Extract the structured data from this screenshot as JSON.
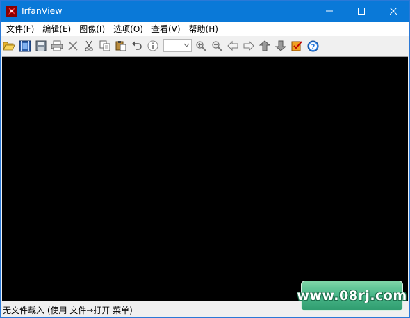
{
  "window": {
    "title": "IrfanView"
  },
  "menu": [
    {
      "label": "文件(F)"
    },
    {
      "label": "编辑(E)"
    },
    {
      "label": "图像(I)"
    },
    {
      "label": "选项(O)"
    },
    {
      "label": "查看(V)"
    },
    {
      "label": "帮助(H)"
    }
  ],
  "toolbar": {
    "icons": [
      "open-folder-icon",
      "slideshow-icon",
      "save-icon",
      "print-icon",
      "delete-icon",
      "cut-icon",
      "copy-icon",
      "paste-icon",
      "undo-icon",
      "info-icon",
      "zoom-in-icon",
      "zoom-out-icon",
      "previous-icon",
      "next-icon",
      "first-icon",
      "last-icon",
      "properties-icon",
      "help-icon"
    ],
    "zoom_value": ""
  },
  "canvas": {
    "background": "#000000"
  },
  "statusbar": {
    "text": "无文件载入 (使用 文件→打开 菜单)"
  },
  "watermark": {
    "text": "www.08rj.com"
  },
  "colors": {
    "titlebar": "#0a79d8",
    "accent_green": "#4bb88a"
  }
}
